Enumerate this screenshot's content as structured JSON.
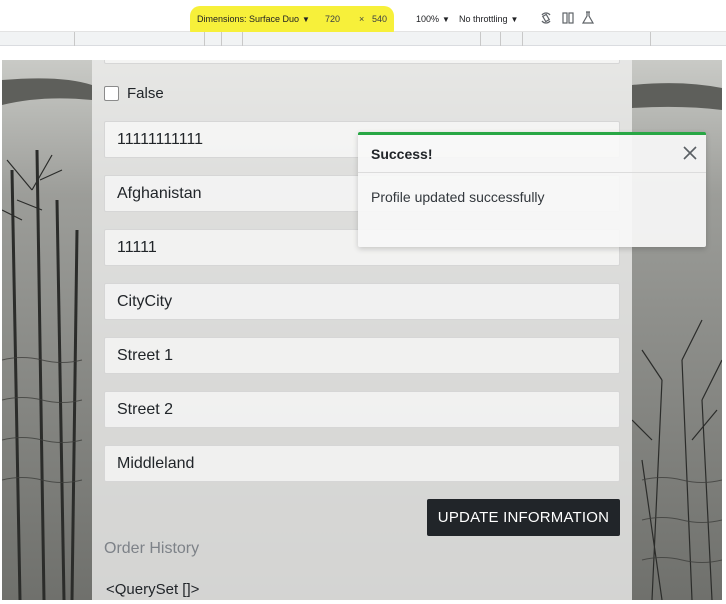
{
  "devtools": {
    "dimensions_label": "Dimensions: Surface Duo",
    "width": "720",
    "times": "×",
    "height": "540",
    "zoom": "100%",
    "throttling": "No throttling",
    "highlight_color": "#f7f03a",
    "icons": [
      "rotate-icon",
      "dual-screen-icon",
      "experiment-icon"
    ]
  },
  "form": {
    "checkbox_label": "False",
    "checkbox_checked": false,
    "phone": "11111111111",
    "country": "Afghanistan",
    "postal_code": "11111",
    "city": "CityCity",
    "street1": "Street 1",
    "street2": "Street 2",
    "region": "Middleland",
    "submit_label": "UPDATE INFORMATION"
  },
  "orders": {
    "heading": "Order History",
    "content": "<QuerySet []>"
  },
  "toast": {
    "title": "Success!",
    "message": "Profile updated successfully",
    "accent_color": "#28a745"
  }
}
